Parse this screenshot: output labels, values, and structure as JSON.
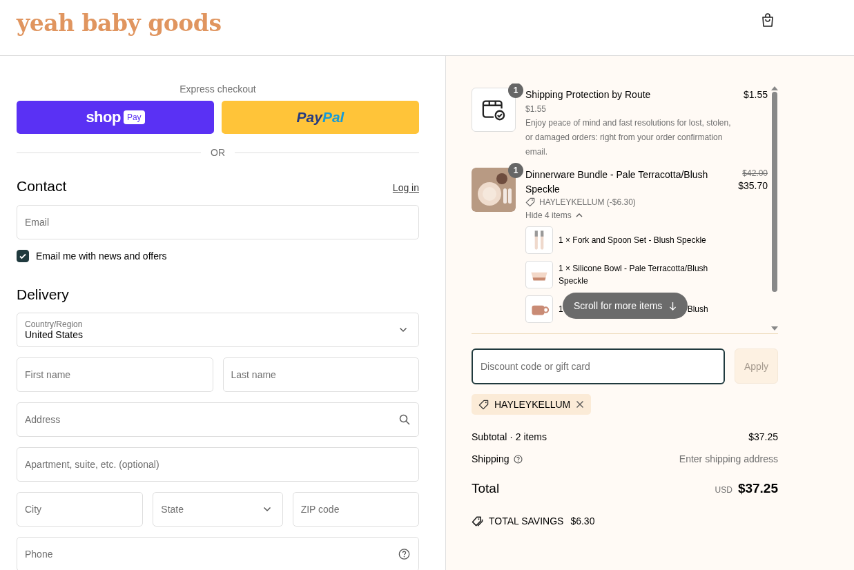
{
  "header": {
    "logo": "yeah baby goods"
  },
  "express_checkout": {
    "title": "Express checkout",
    "buttons": [
      {
        "kind": "shop_pay",
        "label": "shop",
        "badge": "Pay"
      },
      {
        "kind": "paypal",
        "label_1": "Pay",
        "label_2": "Pal"
      }
    ],
    "divider": "OR"
  },
  "contact": {
    "heading": "Contact",
    "login_link": "Log in",
    "email": {
      "placeholder": "Email"
    },
    "newsletter": {
      "label": "Email me with news and offers",
      "checked": true
    }
  },
  "delivery": {
    "heading": "Delivery",
    "rows": [
      [
        {
          "kind": "select",
          "label": "Country/Region",
          "value": "United States"
        }
      ],
      [
        {
          "kind": "text",
          "placeholder": "First name"
        },
        {
          "kind": "text",
          "placeholder": "Last name"
        }
      ],
      [
        {
          "kind": "search",
          "placeholder": "Address"
        }
      ],
      [
        {
          "kind": "text",
          "placeholder": "Apartment, suite, etc. (optional)"
        }
      ],
      [
        {
          "kind": "text",
          "placeholder": "City"
        },
        {
          "kind": "select",
          "placeholder": "State"
        },
        {
          "kind": "text",
          "placeholder": "ZIP code"
        }
      ],
      [
        {
          "kind": "help",
          "placeholder": "Phone"
        }
      ]
    ]
  },
  "order_summary": {
    "items": [
      {
        "kind": "protection",
        "quantity": "1",
        "title": "Shipping Protection by Route",
        "subtitle": "$1.55",
        "description": "Enjoy peace of mind and fast resolutions for lost, stolen, or damaged orders: right from your order confirmation email.",
        "price": "$1.55"
      },
      {
        "kind": "bundle",
        "quantity": "1",
        "title": "Dinnerware Bundle - Pale Terracotta/Blush Speckle",
        "original_price": "$42.00",
        "price": "$35.70",
        "discount": "HAYLEYKELLUM (-$6.30)",
        "toggle": "Hide 4 items",
        "expanded": true,
        "components": [
          {
            "label": "1 × Fork and Spoon Set - Blush Speckle"
          },
          {
            "label": "1 × Silicone Bowl - Pale Terracotta/Blush Speckle"
          },
          {
            "visible_start": "1",
            "visible_end": "Blush"
          }
        ]
      }
    ],
    "scroll_hint": "Scroll for more items",
    "discount": {
      "placeholder": "Discount code or gift card",
      "button": "Apply",
      "applied_codes": [
        {
          "code": "HAYLEYKELLUM"
        }
      ]
    },
    "totals": {
      "subtotal_label": "Subtotal · 2 items",
      "subtotal": "$37.25",
      "shipping_label": "Shipping",
      "shipping": "Enter shipping address",
      "total_label": "Total",
      "currency": "USD",
      "total": "$37.25",
      "savings_label": "TOTAL SAVINGS",
      "savings": "$6.30"
    }
  }
}
